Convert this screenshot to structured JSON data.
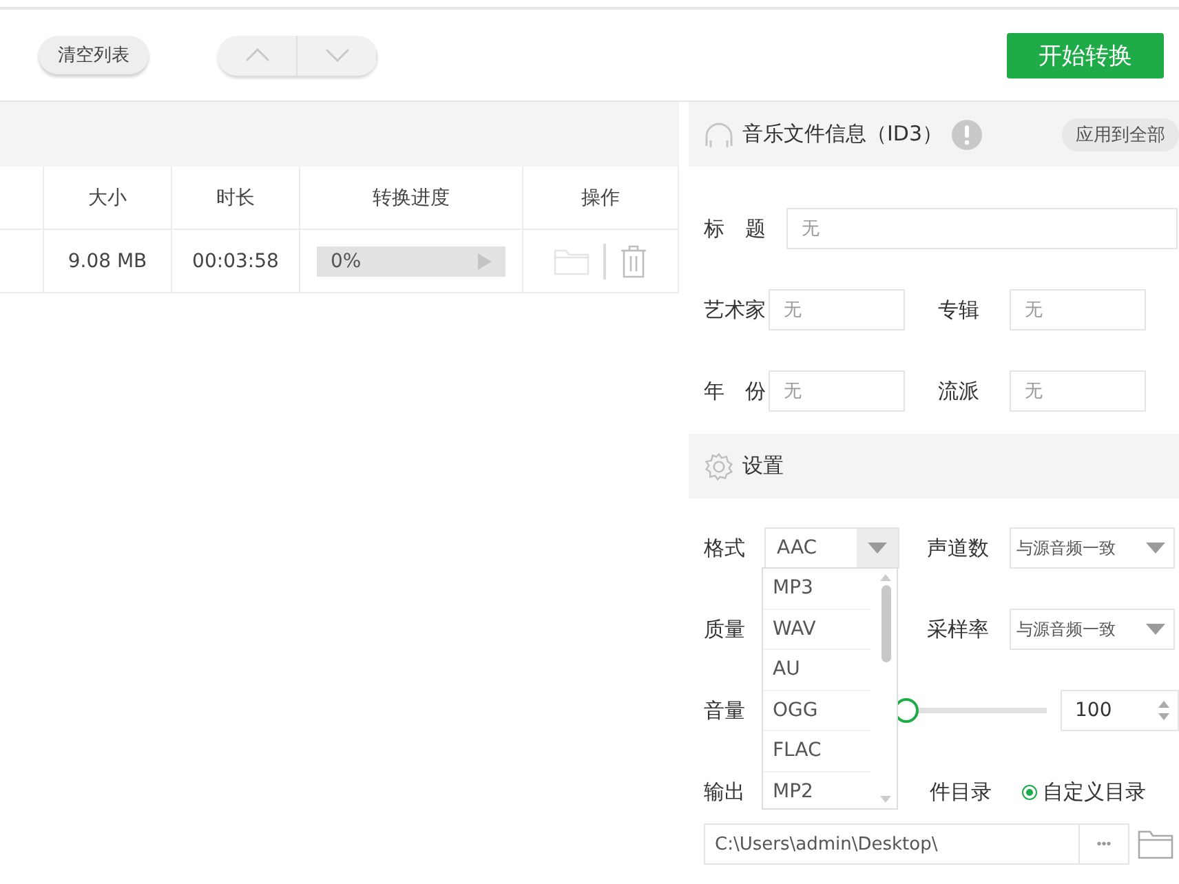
{
  "toolbar": {
    "clear_button": "清空列表",
    "start_button": "开始转换"
  },
  "table": {
    "columns": [
      "大小",
      "时长",
      "转换进度",
      "操作"
    ],
    "rows": [
      {
        "size": "9.08 MB",
        "duration": "00:03:58",
        "progress_text": "0%",
        "level": 0
      }
    ]
  },
  "id3": {
    "title": "音乐文件信息（ID3）",
    "apply_button": "应用到全部",
    "fields": [
      {
        "label": "标　题",
        "placeholder": "无"
      },
      {
        "label": "艺术家",
        "placeholder": "无"
      },
      {
        "label": "专辑",
        "placeholder": "无"
      },
      {
        "label": "年　份",
        "placeholder": "无"
      },
      {
        "label": "流派",
        "placeholder": "无"
      }
    ]
  },
  "settings": {
    "title": "设置",
    "format": {
      "label": "格式",
      "value": "AAC",
      "options": [
        "MP3",
        "WAV",
        "AU",
        "OGG",
        "FLAC",
        "MP2"
      ]
    },
    "channels": {
      "label": "声道数",
      "value": "与源音频一致"
    },
    "quality": {
      "label": "质量"
    },
    "sample_rate": {
      "label": "采样率",
      "value": "与源音频一致"
    },
    "volume": {
      "label": "音量",
      "level": 0.5,
      "value": "100"
    },
    "output": {
      "label": "输出",
      "fragment": "件目录",
      "custom_option": {
        "label": "自定义目录",
        "selected": true
      },
      "path": "C:\\Users\\admin\\Desktop\\",
      "browse": "•••"
    }
  }
}
